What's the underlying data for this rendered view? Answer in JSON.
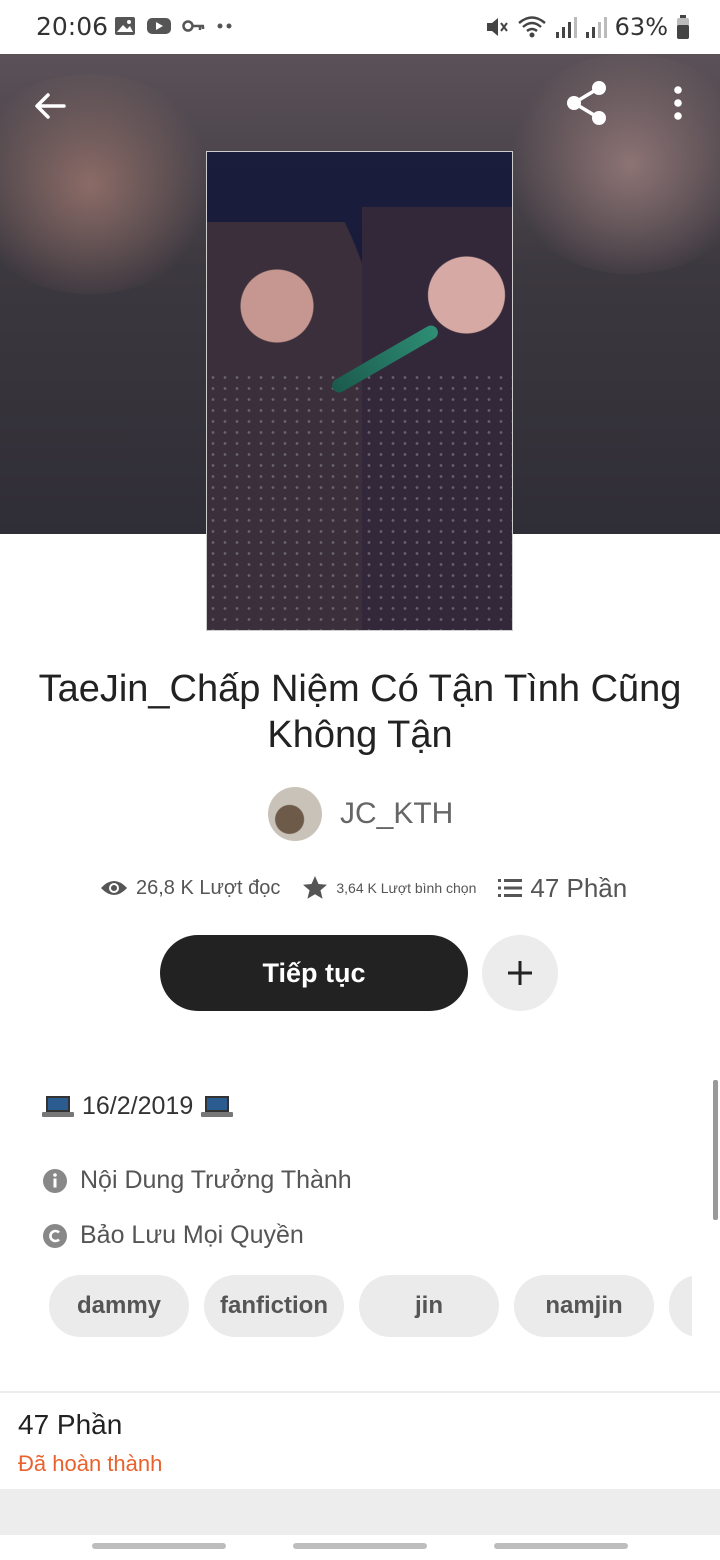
{
  "status_bar": {
    "time": "20:06",
    "battery": "63%"
  },
  "story": {
    "title": "TaeJin_Chấp Niệm Có Tận Tình Cũng Không Tận",
    "author": "JC_KTH",
    "reads": "26,8 K Lượt đọc",
    "votes": "3,64 K Lượt bình chọn",
    "parts": "47 Phần"
  },
  "actions": {
    "continue_label": "Tiếp tục",
    "add_symbol": "+"
  },
  "details": {
    "date": "16/2/2019",
    "mature": "Nội Dung Trưởng Thành",
    "copyright": "Bảo Lưu Mọi Quyền"
  },
  "tags": [
    "dammy",
    "fanfiction",
    "jin",
    "namjin"
  ],
  "parts_section": {
    "count": "47 Phần",
    "status": "Đã hoàn thành"
  },
  "colors": {
    "accent": "#e8622d",
    "button_dark": "#222222",
    "tag_bg": "#ebebeb"
  }
}
